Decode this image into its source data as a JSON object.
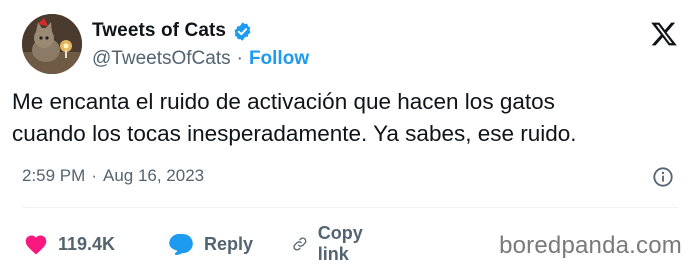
{
  "author": {
    "display_name": "Tweets of Cats",
    "handle": "@TweetsOfCats",
    "separator": "·",
    "follow_label": "Follow",
    "verified_icon": "verified-badge-icon"
  },
  "tweet": {
    "text": "Me encanta el ruido de activación que hacen los gatos\ncuando los tocas inesperadamente. Ya sabes, ese ruido.",
    "time": "2:59 PM",
    "separator": "·",
    "date": "Aug 16, 2023"
  },
  "actions": {
    "likes_count": "119.4K",
    "reply_label": "Reply",
    "copy_link_label": "Copy link"
  },
  "watermark": "boredpanda.com",
  "colors": {
    "accent": "#1d9bf0",
    "like": "#f91880",
    "secondary_text": "#536471",
    "text": "#0f1419"
  }
}
